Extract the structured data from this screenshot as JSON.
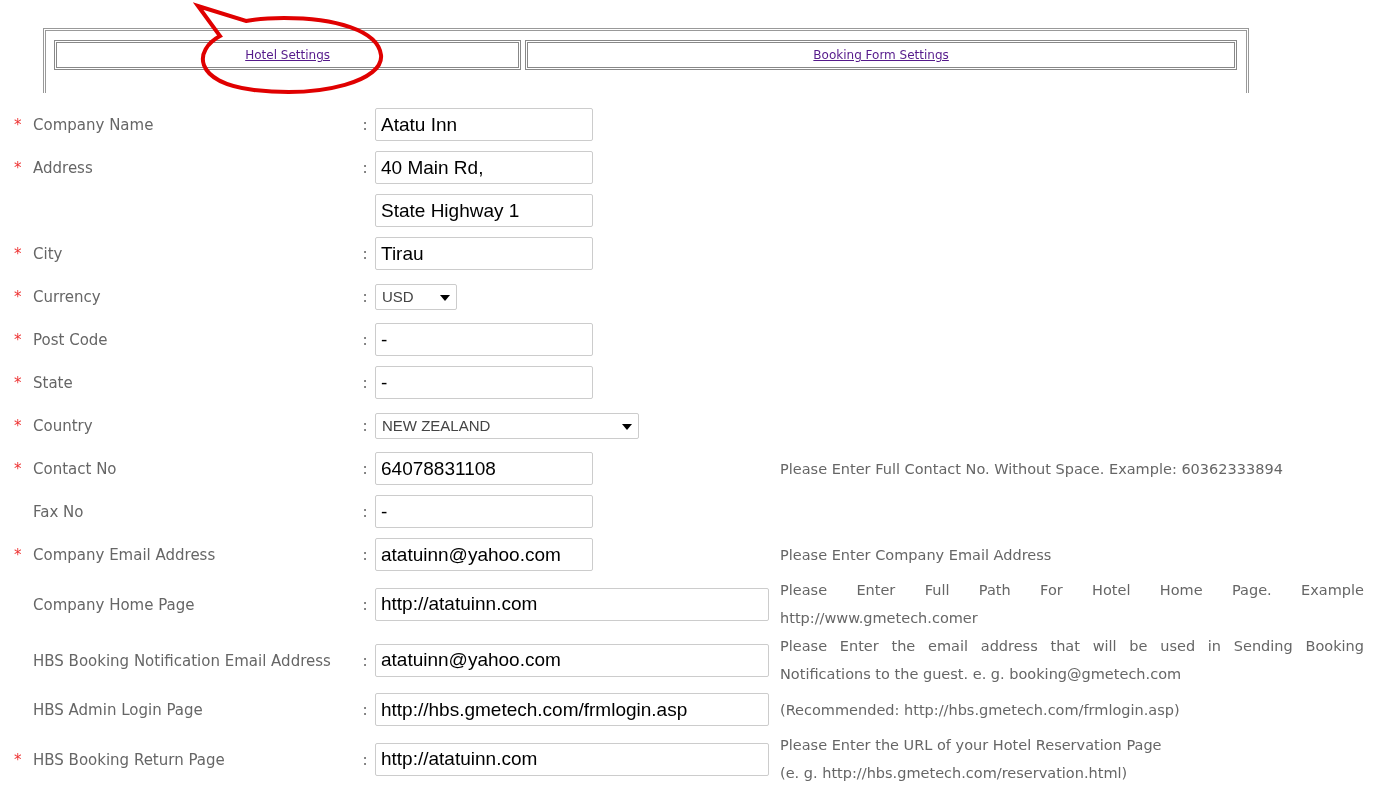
{
  "tabs": [
    {
      "label": "Hotel Settings"
    },
    {
      "label": "Booking Form Settings"
    }
  ],
  "rows": [
    {
      "marker": "*",
      "label": "Company Name",
      "colon": ":",
      "field": {
        "kind": "short-text",
        "value": "Atatu Inn"
      }
    },
    {
      "marker": "*",
      "label": "Address",
      "colon": ":",
      "field": {
        "kind": "short-text",
        "value": "40 Main Rd,"
      }
    },
    {
      "field": {
        "kind": "short-text",
        "value": "State Highway 1"
      }
    },
    {
      "marker": "*",
      "label": "City",
      "colon": ":",
      "field": {
        "kind": "short-text",
        "value": "Tirau"
      }
    },
    {
      "marker": "*",
      "label": "Currency",
      "colon": ":",
      "field": {
        "kind": "short-select",
        "value": "USD"
      }
    },
    {
      "marker": "*",
      "label": "Post Code",
      "colon": ":",
      "field": {
        "kind": "short-text",
        "value": "-"
      }
    },
    {
      "marker": "*",
      "label": "State",
      "colon": ":",
      "field": {
        "kind": "short-text",
        "value": "-"
      }
    },
    {
      "marker": "*",
      "label": "Country",
      "colon": ":",
      "field": {
        "kind": "long-select",
        "value": "NEW ZEALAND"
      }
    },
    {
      "marker": "*",
      "label": "Contact No",
      "colon": ":",
      "field": {
        "kind": "short-text",
        "value": "64078831108"
      },
      "hint": [
        "Please Enter Full Contact No. Without Space. Example: 60362333894"
      ]
    },
    {
      "label": "Fax No",
      "colon": ":",
      "field": {
        "kind": "short-text",
        "value": "-"
      }
    },
    {
      "marker": "*",
      "label": "Company Email Address",
      "colon": ":",
      "field": {
        "kind": "short-text",
        "value": "atatuinn@yahoo.com"
      },
      "hint": [
        "Please Enter Company Email Address"
      ]
    },
    {
      "label": "Company Home Page",
      "colon": ":",
      "field": {
        "kind": "long-text",
        "value": "http://atatuinn.com"
      },
      "hint": [
        "Please Enter Full Path For Hotel Home Page. Example http://www.gmetech.comer"
      ]
    },
    {
      "label": "HBS Booking Notification Email Address",
      "colon": ":",
      "field": {
        "kind": "long-text",
        "value": "atatuinn@yahoo.com"
      },
      "hint": [
        "Please Enter the email address that will be used in Sending Booking Notifications to the guest. e. g. booking@gmetech.com"
      ]
    },
    {
      "label": "HBS Admin Login Page",
      "colon": ":",
      "field": {
        "kind": "long-text",
        "value": "http://hbs.gmetech.com/frmlogin.asp"
      },
      "hint": [
        "(Recommended: http://hbs.gmetech.com/frmlogin.asp)"
      ]
    },
    {
      "marker": "*",
      "label": "HBS Booking Return Page",
      "colon": ":",
      "field": {
        "kind": "long-text",
        "value": "http://atatuinn.com"
      },
      "hint": [
        "Please Enter the URL of your Hotel Reservation Page",
        "(e. g. http://hbs.gmetech.com/reservation.html)"
      ]
    }
  ]
}
